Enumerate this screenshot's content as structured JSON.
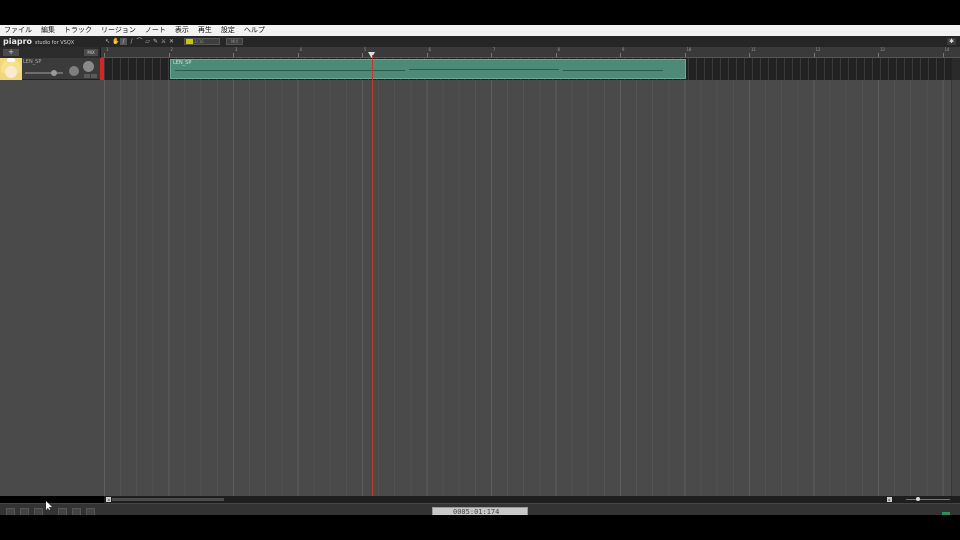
{
  "menu": [
    "ファイル",
    "編集",
    "トラック",
    "リージョン",
    "ノート",
    "表示",
    "再生",
    "設定",
    "ヘルプ"
  ],
  "app": {
    "logo": "piapro",
    "logo_sub": "studio for VSQX"
  },
  "toolbar": {
    "tool_icons": [
      "pointer-icon",
      "hand-icon",
      "pencil-icon",
      "line-icon",
      "curve-icon",
      "eraser-icon",
      "brush-icon",
      "knife-icon",
      "cross-icon"
    ],
    "snap_value": "1/16",
    "mode_label": "MIX"
  },
  "track_header": {
    "add_button": "+",
    "menu_button": "MIX"
  },
  "ruler": {
    "numbers": [
      "1",
      "2",
      "3",
      "4",
      "5",
      "6",
      "7",
      "8",
      "9",
      "10",
      "11",
      "12",
      "13",
      "14"
    ]
  },
  "track": {
    "name": "LEN_SP",
    "region_label": "LEN_SP",
    "volume": 0.75
  },
  "transport": {
    "time": "0005:01:174"
  },
  "colors": {
    "region": "#4e8a78",
    "playhead": "#c0392b",
    "grid": "#4a4a4a",
    "record": "#dd2222"
  }
}
